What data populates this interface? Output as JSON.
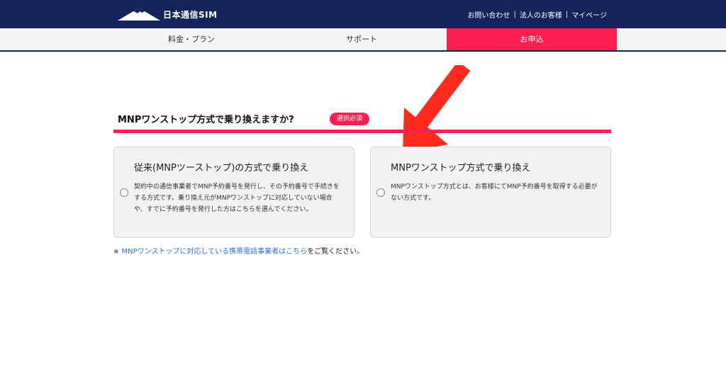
{
  "header": {
    "logo_text": "日本通信SIM",
    "links": [
      "お問い合わせ",
      "法人のお客様",
      "マイページ"
    ],
    "separator": "|"
  },
  "nav": {
    "items": [
      {
        "label": "料金・プラン",
        "active": false
      },
      {
        "label": "サポート",
        "active": false
      },
      {
        "label": "お申込",
        "active": true
      }
    ]
  },
  "question": {
    "title": "MNPワンストップ方式で乗り換えますか?",
    "badge": "選択必須"
  },
  "options": [
    {
      "title": "従来(MNPツーストップ)の方式で乗り換え",
      "description": "契約中の通信事業者でMNP予約番号を発行し、その予約番号で手続きをする方式です。乗り換え元がMNPワンストップに対応していない場合や、すでに予約番号を発行した方はこちらを選んでください。",
      "selected": false
    },
    {
      "title": "MNPワンストップ方式で乗り換え",
      "description": "MNPワンストップ方式とは、お客様にてMNP予約番号を取得する必要がない方式です。",
      "selected": false
    }
  ],
  "note": {
    "mark": "※",
    "link_text": "MNPワンストップに対応している携帯電話事業者はこちら",
    "suffix": "をご覧ください。"
  },
  "colors": {
    "navy": "#13245c",
    "accent": "#ff1e50",
    "link": "#2f6fd0"
  },
  "icons": {
    "logo": "mount-fuji-icon",
    "arrow": "red-arrow-annotation-icon"
  }
}
